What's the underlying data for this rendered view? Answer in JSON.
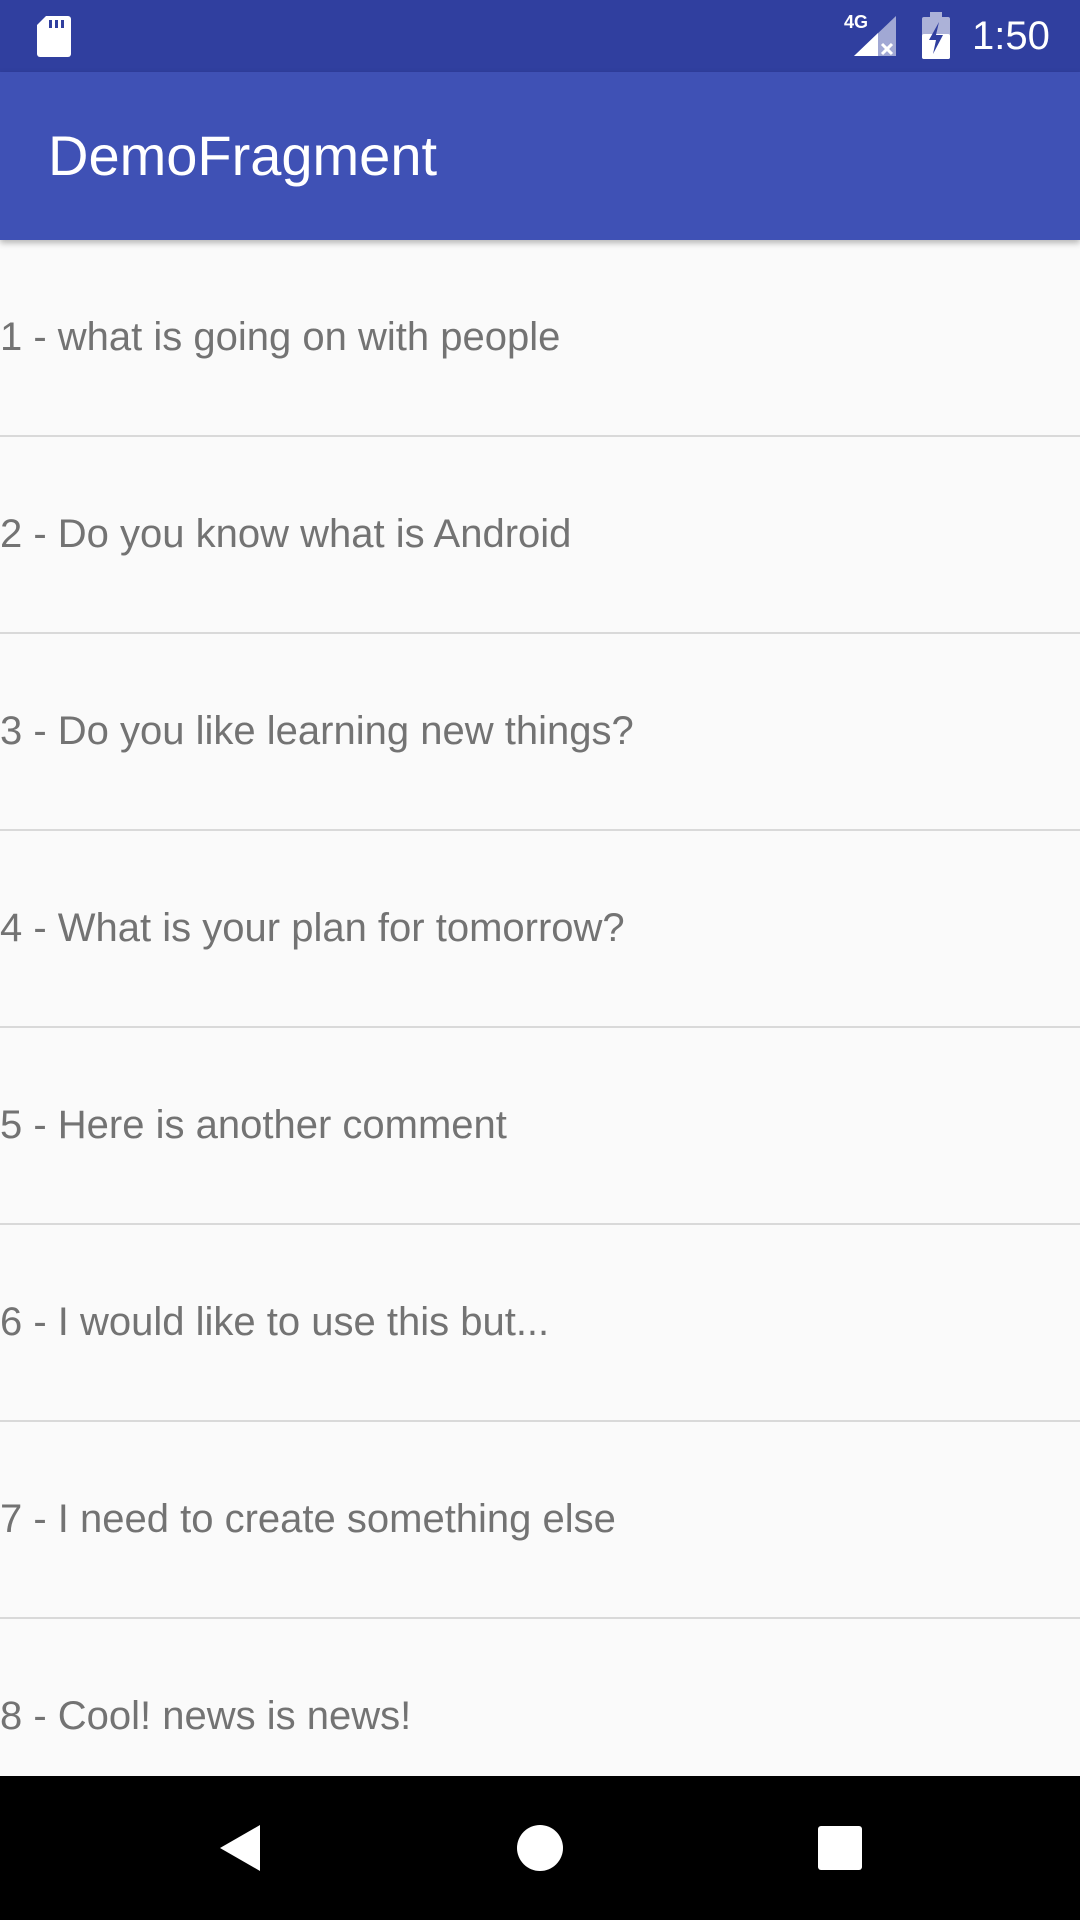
{
  "status_bar": {
    "time": "1:50",
    "network_label": "4G",
    "icons": [
      "sd-card-icon",
      "signal-icon",
      "battery-icon"
    ],
    "background": "#303f9f"
  },
  "app_bar": {
    "title": "DemoFragment",
    "background": "#3f51b5"
  },
  "list": {
    "items": [
      {
        "label": "1 - what is going on with people"
      },
      {
        "label": "2 - Do you know what is Android"
      },
      {
        "label": "3 - Do you like learning new things?"
      },
      {
        "label": "4 - What is your plan for tomorrow?"
      },
      {
        "label": "5 - Here is another comment"
      },
      {
        "label": "6 - I would like to use this but..."
      },
      {
        "label": "7 - I need to create something else"
      },
      {
        "label": "8 - Cool! news is news!"
      }
    ]
  },
  "nav_bar": {
    "buttons": [
      "back-icon",
      "home-icon",
      "recents-icon"
    ],
    "background": "#000000"
  }
}
